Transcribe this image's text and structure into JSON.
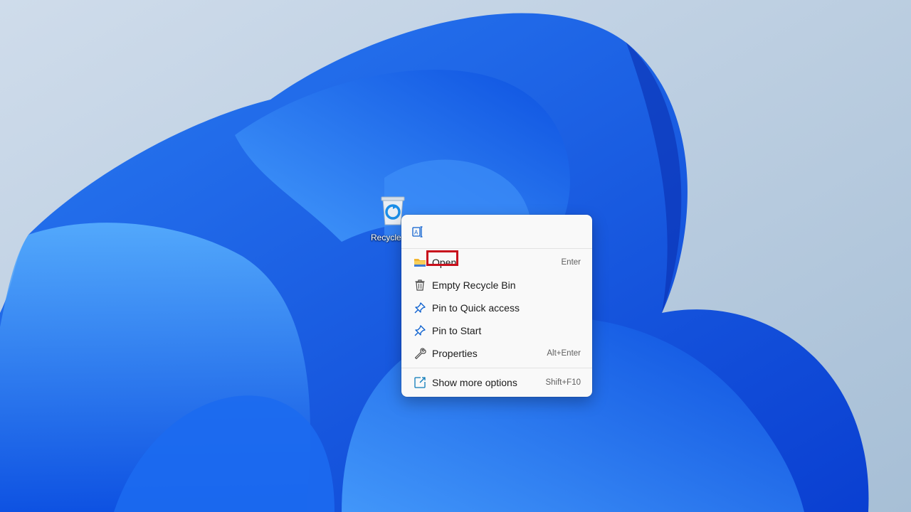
{
  "desktop": {
    "icons": [
      {
        "label": "Recycle Bin",
        "icon": "recycle-bin-icon"
      }
    ]
  },
  "context_menu": {
    "top_actions": [
      {
        "name": "rename",
        "icon": "rename-icon"
      }
    ],
    "items": [
      {
        "label": "Open",
        "shortcut": "Enter",
        "icon": "folder-icon",
        "highlighted": true
      },
      {
        "label": "Empty Recycle Bin",
        "shortcut": "",
        "icon": "trash-icon"
      },
      {
        "label": "Pin to Quick access",
        "shortcut": "",
        "icon": "pin-icon"
      },
      {
        "label": "Pin to Start",
        "shortcut": "",
        "icon": "pin-icon"
      },
      {
        "label": "Properties",
        "shortcut": "Alt+Enter",
        "icon": "wrench-icon"
      }
    ],
    "more": {
      "label": "Show more options",
      "shortcut": "Shift+F10",
      "icon": "share-icon"
    }
  },
  "colors": {
    "highlight_border": "#c8101c",
    "menu_background": "#f9f9f9",
    "icon_accent": "#0a5fcf"
  }
}
